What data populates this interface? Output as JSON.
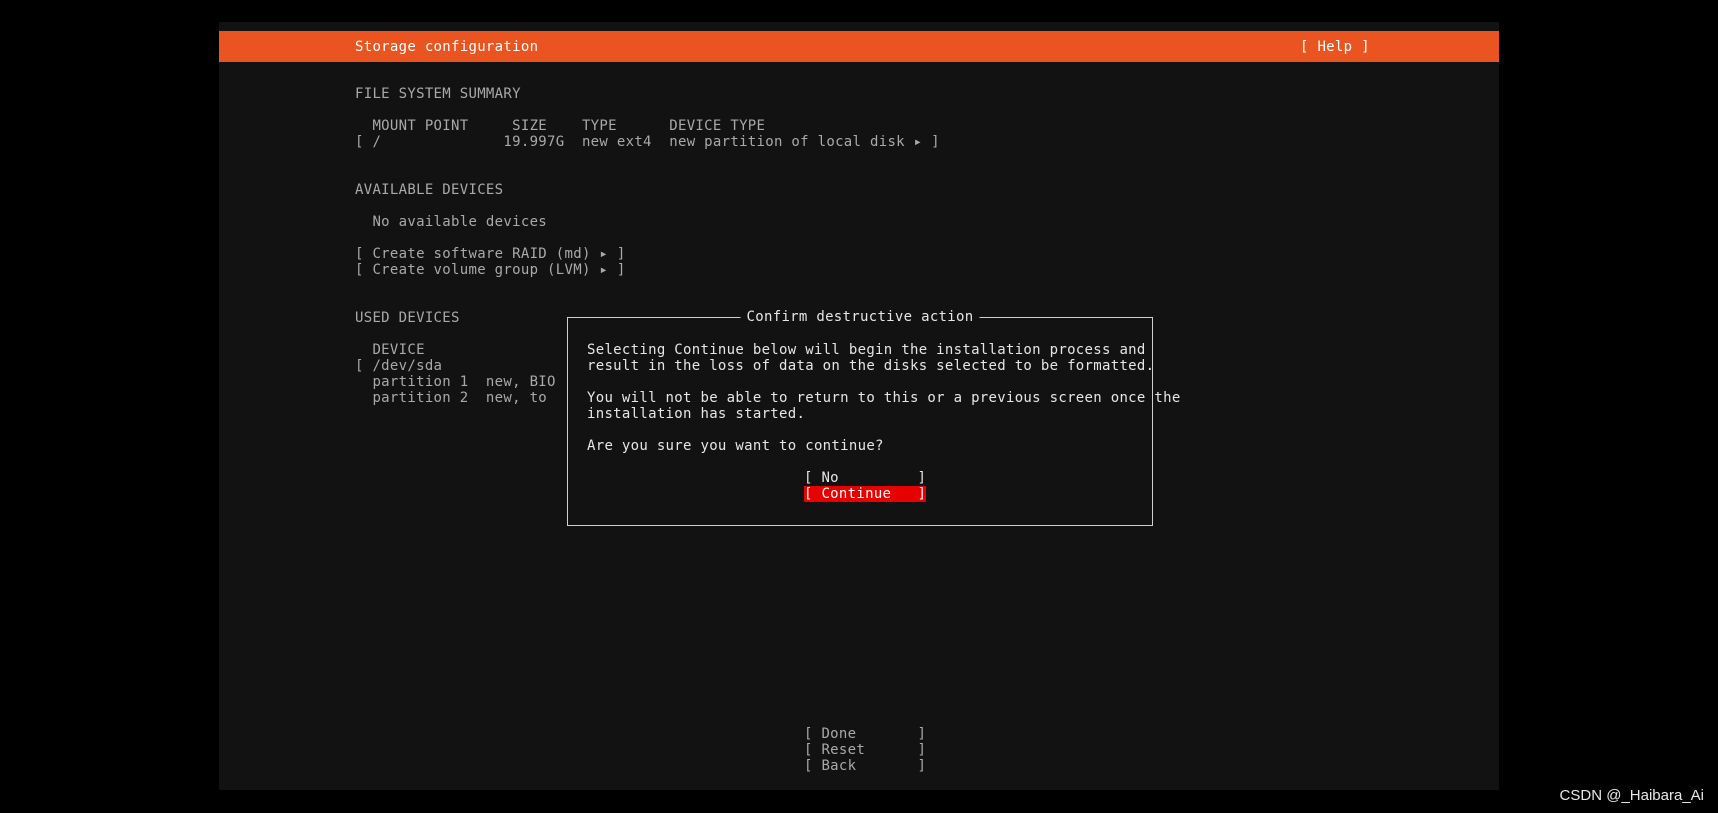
{
  "header": {
    "title": "Storage configuration",
    "help": "[ Help ]"
  },
  "fs_summary": {
    "heading": "FILE SYSTEM SUMMARY",
    "columns": "  MOUNT POINT     SIZE    TYPE      DEVICE TYPE",
    "row": "[ /              19.997G  new ext4  new partition of local disk ▸ ]"
  },
  "available": {
    "heading": "AVAILABLE DEVICES",
    "none": "  No available devices",
    "raid": "[ Create software RAID (md) ▸ ]",
    "lvm": "[ Create volume group (LVM) ▸ ]"
  },
  "used": {
    "heading": "USED DEVICES",
    "column": "  DEVICE",
    "rows": [
      "[ /dev/sda",
      "  partition 1  new, BIO",
      "  partition 2  new, to"
    ]
  },
  "dialog": {
    "title": "Confirm destructive action",
    "p1_line1": "Selecting Continue below will begin the installation process and",
    "p1_line2": "result in the loss of data on the disks selected to be formatted.",
    "p2_line1": "You will not be able to return to this or a previous screen once the",
    "p2_line2": "installation has started.",
    "question": "Are you sure you want to continue?",
    "no": "[ No         ]",
    "continue": "[ Continue   ]"
  },
  "footer": {
    "done": "[ Done       ]",
    "reset": "[ Reset      ]",
    "back": "[ Back       ]"
  },
  "watermark": "CSDN @_Haibara_Ai"
}
